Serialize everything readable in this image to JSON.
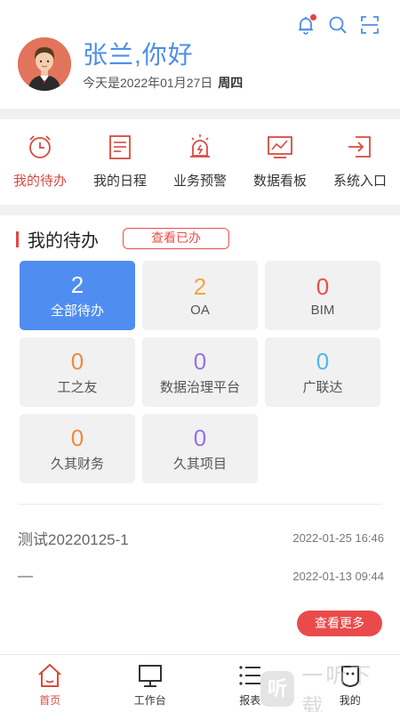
{
  "header": {
    "greeting": "张兰,你好",
    "date_prefix": "今天是2022年01月27日",
    "weekday": "周四",
    "icons": [
      "bell-icon",
      "search-icon",
      "scan-icon"
    ],
    "notification_dot_color": "#e84040"
  },
  "quick_nav": [
    {
      "label": "我的待办",
      "icon": "clock-icon",
      "active": true
    },
    {
      "label": "我的日程",
      "icon": "schedule-icon",
      "active": false
    },
    {
      "label": "业务预警",
      "icon": "alarm-icon",
      "active": false
    },
    {
      "label": "数据看板",
      "icon": "dashboard-icon",
      "active": false
    },
    {
      "label": "系统入口",
      "icon": "entry-icon",
      "active": false
    }
  ],
  "todo_section": {
    "title": "我的待办",
    "view_done_label": "查看已办",
    "cards": [
      {
        "count": "2",
        "name": "全部待办",
        "color": "#ffffff",
        "selected": true
      },
      {
        "count": "2",
        "name": "OA",
        "color": "#f4a63a",
        "selected": false
      },
      {
        "count": "0",
        "name": "BIM",
        "color": "#e8504a",
        "selected": false
      },
      {
        "count": "0",
        "name": "工之友",
        "color": "#f08a3c",
        "selected": false
      },
      {
        "count": "0",
        "name": "数据治理平台",
        "color": "#9b6fe0",
        "selected": false
      },
      {
        "count": "0",
        "name": "广联达",
        "color": "#4fb8f0",
        "selected": false
      },
      {
        "count": "0",
        "name": "久其财务",
        "color": "#f08a3c",
        "selected": false
      },
      {
        "count": "0",
        "name": "久其项目",
        "color": "#9b6fe0",
        "selected": false
      }
    ],
    "items": [
      {
        "title": "测试20220125-1",
        "time": "2022-01-25 16:46"
      },
      {
        "title": "—",
        "time": "2022-01-13 09:44"
      }
    ],
    "more_label": "查看更多"
  },
  "tabbar": [
    {
      "label": "首页",
      "icon": "home-icon",
      "active": true
    },
    {
      "label": "工作台",
      "icon": "monitor-icon",
      "active": false
    },
    {
      "label": "报表",
      "icon": "report-icon",
      "active": false
    },
    {
      "label": "我的",
      "icon": "profile-icon",
      "active": false
    }
  ],
  "watermark": {
    "logo_text": "听",
    "text": "一听下载"
  },
  "colors": {
    "accent_red": "#e84545",
    "accent_blue": "#4d8ee8",
    "card_bg": "#f1f1f2"
  }
}
